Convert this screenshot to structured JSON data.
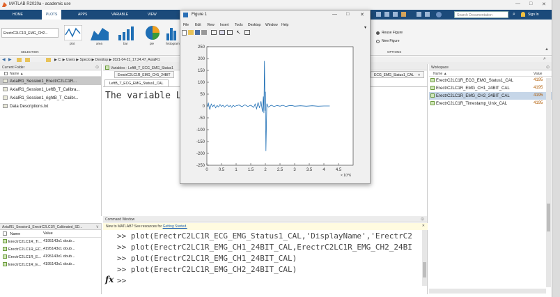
{
  "window": {
    "title": "MATLAB R2020a - academic use",
    "controls": [
      "—",
      "□",
      "✕"
    ]
  },
  "ribbon": {
    "tabs": [
      "HOME",
      "PLOTS",
      "APPS",
      "VARIABLE",
      "VIEW"
    ],
    "active_tab": "PLOTS",
    "search_placeholder": "Search Documentation",
    "sign_in": "Sign In",
    "selection_label": "SELECTION",
    "selected_variable": "ErectrC2LC1R_EMG_CH2...",
    "plot_types": [
      "plot",
      "area",
      "bar",
      "pie",
      "histogram"
    ],
    "reuse_figure": "Reuse Figure",
    "new_figure": "New Figure",
    "options_label": "OPTIONS"
  },
  "address": {
    "path": "▶ C: ▶ Users ▶ Specto ▶ Desktop ▶ 2021-04-21_17.24.47_AxialR1"
  },
  "current_folder": {
    "title": "Current Folder",
    "name_header": "Name",
    "files": [
      "AxialR1_Session1_ErectrC2LC1R...",
      "AxialR1_Session1_LeftB_T_Calibra...",
      "AxialR1_Session1_rightB_T_Calibr...",
      "Data Descriptions.txt"
    ],
    "selected_index": 0
  },
  "details_panel": {
    "title": "AxialR1_Session1_ErectrC2LC1R_Calibrated_SD...",
    "headers": [
      "Name",
      "Value"
    ],
    "rows": [
      {
        "name": "ErectrC2LC1R_Ti...",
        "value": "4195143x1 doub..."
      },
      {
        "name": "ErectrC2LC1R_EC...",
        "value": "4195143x1 doub..."
      },
      {
        "name": "ErectrC2LC1R_E...",
        "value": "4195143x1 doub..."
      },
      {
        "name": "ErectrC2LC1R_E...",
        "value": "4195143x1 doub..."
      }
    ]
  },
  "variables": {
    "title": "Variables - LeftB_T_ECG_EMG_Status1",
    "tabs": [
      "ErectrC2LC1R_EMG_CH1_24BIT",
      "ECG_EMG_Status1_CAL"
    ],
    "subtab": "LeftB_T_ECG_EMG_Status1_CAL",
    "body_text": "The variable Lef"
  },
  "command_window": {
    "title": "Command Window",
    "notice_prefix": "New to MATLAB? See resources for ",
    "notice_link": "Getting Started.",
    "lines": [
      ">> plot(ErectrC2LC1R_ECG_EMG_Status1_CAL,'DisplayName','ErectrC2",
      ">> plot(ErectrC2LC1R_EMG_CH1_24BIT_CAL,ErectrC2LC1R_EMG_CH2_24BI",
      ">> plot(ErectrC2LC1R_EMG_CH1_24BIT_CAL)",
      ">> plot(ErectrC2LC1R_EMG_CH2_24BIT_CAL)"
    ],
    "prompt": ">>",
    "fx": "fx"
  },
  "workspace": {
    "title": "Workspace",
    "headers": [
      "Name",
      "Value"
    ],
    "rows": [
      {
        "name": "ErectrC2LC1R_ECG_EMG_Status1_CAL",
        "value": "4195"
      },
      {
        "name": "ErectrC2LC1R_EMG_CH1_24BIT_CAL",
        "value": "4195"
      },
      {
        "name": "ErectrC2LC1R_EMG_CH2_24BIT_CAL",
        "value": "4195"
      },
      {
        "name": "ErectrC2LC1R_Timestamp_Unix_CAL",
        "value": "4195"
      }
    ],
    "selected_index": 2
  },
  "figure": {
    "title": "Figure 1",
    "menu": [
      "File",
      "Edit",
      "View",
      "Insert",
      "Tools",
      "Desktop",
      "Window",
      "Help"
    ],
    "colors": {
      "line": "#1f6fb5"
    }
  },
  "chart_data": {
    "type": "line",
    "title": "",
    "xlabel": "",
    "ylabel": "",
    "xlim": [
      0,
      5
    ],
    "ylim": [
      -250,
      250
    ],
    "x_exponent": "× 10^6",
    "xticks": [
      "0",
      "0.5",
      "1",
      "1.5",
      "2",
      "2.5",
      "3",
      "3.5",
      "4",
      "4.5"
    ],
    "yticks": [
      "250",
      "200",
      "150",
      "100",
      "50",
      "0",
      "-50",
      "-100",
      "-150",
      "-200",
      "-250"
    ],
    "series": [
      {
        "x": [
          0,
          0.05,
          0.1,
          0.15,
          0.2,
          0.25,
          0.3,
          0.35,
          0.4,
          0.45,
          0.5,
          0.55,
          0.6,
          0.65,
          0.7,
          0.75,
          0.8,
          0.85,
          0.9,
          0.95,
          1.0,
          1.1,
          1.2,
          1.3,
          1.4,
          1.5,
          1.6,
          1.65,
          1.7,
          1.75,
          1.8,
          1.85,
          1.9,
          1.93,
          1.95,
          1.97,
          1.99,
          2.0,
          2.02,
          2.05,
          2.1,
          2.2,
          2.3,
          2.4,
          2.5,
          2.6,
          2.7,
          2.8,
          2.9,
          3.0,
          3.2,
          3.4,
          3.6,
          3.8,
          4.0,
          4.2
        ],
        "y": [
          -5,
          12,
          -15,
          8,
          -3,
          5,
          -8,
          2,
          -4,
          6,
          -2,
          3,
          -5,
          1,
          4,
          -3,
          2,
          -6,
          3,
          -2,
          1,
          4,
          -3,
          5,
          -2,
          3,
          -6,
          8,
          -12,
          15,
          -8,
          20,
          -25,
          40,
          -30,
          190,
          -20,
          60,
          -190,
          10,
          -5,
          3,
          -2,
          2,
          -1,
          3,
          -2,
          1,
          2,
          -1,
          1,
          -1,
          1,
          -1,
          0,
          0
        ]
      }
    ]
  }
}
